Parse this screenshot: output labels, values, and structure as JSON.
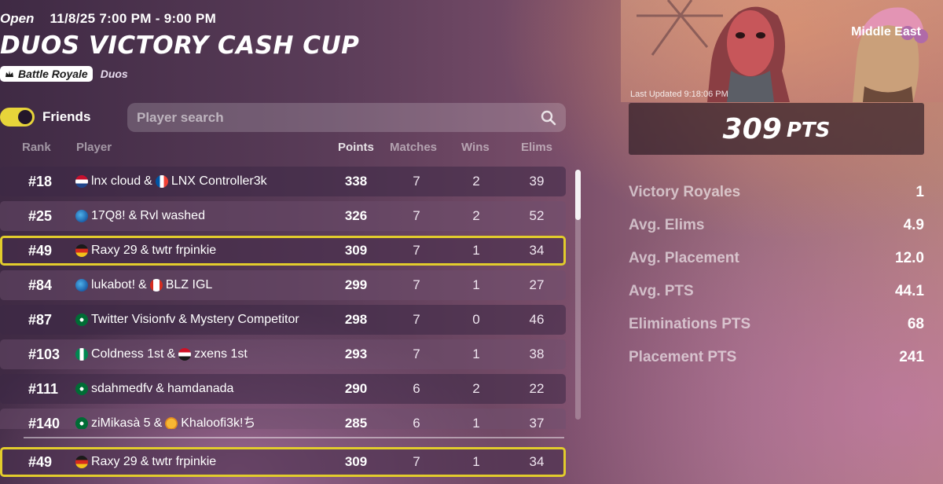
{
  "event": {
    "status": "Open",
    "time": "11/8/25 7:00 PM - 9:00 PM",
    "title": "DUOS VICTORY CASH CUP",
    "mode": "Battle Royale",
    "format": "Duos"
  },
  "controls": {
    "friends_label": "Friends",
    "friends_on": true,
    "search_placeholder": "Player search"
  },
  "table": {
    "headers": {
      "rank": "Rank",
      "player": "Player",
      "points": "Points",
      "matches": "Matches",
      "wins": "Wins",
      "elims": "Elims"
    },
    "rows": [
      {
        "rank": "#18",
        "p1": "lnx cloud",
        "p2": "LNX Controller3k",
        "f1": "netherlands",
        "f2": "france",
        "points": "338",
        "matches": "7",
        "wins": "2",
        "elims": "39"
      },
      {
        "rank": "#25",
        "p1": "17Q8!",
        "p2": "Rvl washed",
        "f1": "globe",
        "f2": "",
        "points": "326",
        "matches": "7",
        "wins": "2",
        "elims": "52"
      },
      {
        "rank": "#49",
        "p1": "Raxy 29",
        "p2": "twtr frpinkie",
        "f1": "germany",
        "f2": "",
        "points": "309",
        "matches": "7",
        "wins": "1",
        "elims": "34",
        "highlight": true
      },
      {
        "rank": "#84",
        "p1": "lukabot!",
        "p2": "BLZ IGL",
        "f1": "globe",
        "f2": "canada",
        "points": "299",
        "matches": "7",
        "wins": "1",
        "elims": "27"
      },
      {
        "rank": "#87",
        "p1": "Twitter Visionfv",
        "p2": "Mystery Competitor",
        "f1": "saudi",
        "f2": "",
        "points": "298",
        "matches": "7",
        "wins": "0",
        "elims": "46"
      },
      {
        "rank": "#103",
        "p1": "Coldness 1st",
        "p2": "zxens 1st",
        "f1": "nigeria",
        "f2": "egypt",
        "points": "293",
        "matches": "7",
        "wins": "1",
        "elims": "38"
      },
      {
        "rank": "#111",
        "p1": "sdahmedfv",
        "p2": "hamdanada",
        "f1": "saudi",
        "f2": "",
        "points": "290",
        "matches": "6",
        "wins": "2",
        "elims": "22"
      },
      {
        "rank": "#140",
        "p1": "ziMikasà 5",
        "p2": "Khaloofi3k!ち",
        "f1": "saudi",
        "f2": "sun",
        "points": "285",
        "matches": "6",
        "wins": "1",
        "elims": "37"
      }
    ],
    "my_row": {
      "rank": "#49",
      "p1": "Raxy 29",
      "p2": "twtr frpinkie",
      "f1": "germany",
      "points": "309",
      "matches": "7",
      "wins": "1",
      "elims": "34"
    },
    "scroll_position": 0.0
  },
  "summary": {
    "region": "Middle East",
    "last_updated": "Last Updated 9:18:06 PM",
    "points": "309",
    "points_unit": "PTS",
    "stats": [
      {
        "label": "Victory Royales",
        "value": "1"
      },
      {
        "label": "Avg. Elims",
        "value": "4.9"
      },
      {
        "label": "Avg. Placement",
        "value": "12.0"
      },
      {
        "label": "Avg. PTS",
        "value": "44.1"
      },
      {
        "label": "Eliminations PTS",
        "value": "68"
      },
      {
        "label": "Placement PTS",
        "value": "241"
      }
    ]
  },
  "colors": {
    "accent": "#e2cc2c",
    "row_dark": "#3c2846",
    "row_light": "#6e506e"
  }
}
